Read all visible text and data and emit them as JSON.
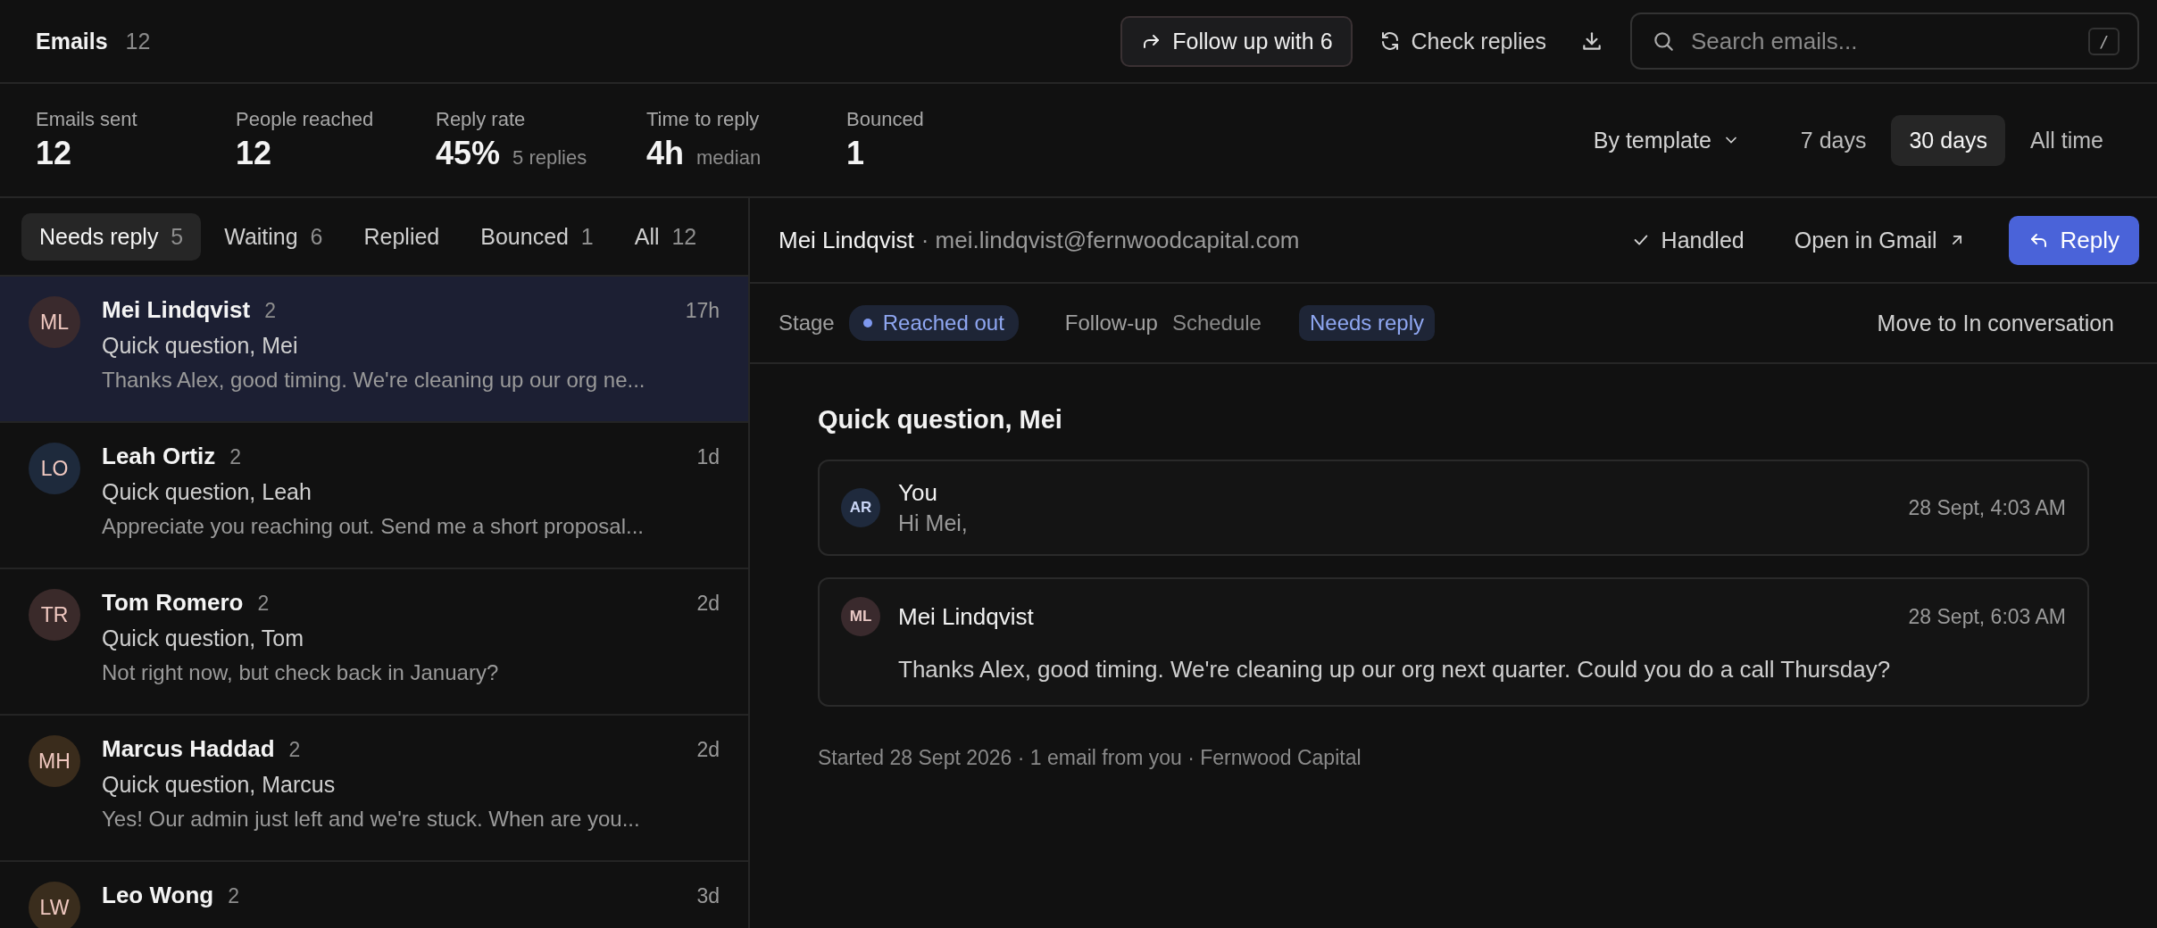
{
  "header": {
    "title": "Emails",
    "count": "12",
    "follow_up_button": "Follow up with 6",
    "check_replies_button": "Check replies",
    "search": {
      "placeholder": "Search emails...",
      "shortcut": "/"
    }
  },
  "stats": [
    {
      "label": "Emails sent",
      "value": "12"
    },
    {
      "label": "People reached",
      "value": "12"
    },
    {
      "label": "Reply rate",
      "value": "45%",
      "note": "5 replies"
    },
    {
      "label": "Time to reply",
      "value": "4h",
      "note": "median"
    },
    {
      "label": "Bounced",
      "value": "1"
    }
  ],
  "grouping": "By template",
  "periods": [
    {
      "label": "7 days",
      "selected": false
    },
    {
      "label": "30 days",
      "selected": true
    },
    {
      "label": "All time",
      "selected": false
    }
  ],
  "tabs": [
    {
      "label": "Needs reply",
      "count": "5",
      "selected": true
    },
    {
      "label": "Waiting",
      "count": "6",
      "selected": false
    },
    {
      "label": "Replied",
      "selected": false
    },
    {
      "label": "Bounced",
      "count": "1",
      "selected": false
    },
    {
      "label": "All",
      "count": "12",
      "selected": false
    }
  ],
  "threads": [
    {
      "initials": "ML",
      "color": "#3a2a2d",
      "name": "Mei Lindqvist",
      "count": "2",
      "time": "17h",
      "subject": "Quick question, Mei",
      "preview": "Thanks Alex, good timing. We're cleaning up our org ne...",
      "selected": true
    },
    {
      "initials": "LO",
      "color": "#1e2a3c",
      "name": "Leah Ortiz",
      "count": "2",
      "time": "1d",
      "subject": "Quick question, Leah",
      "preview": "Appreciate you reaching out. Send me a short proposal...",
      "selected": false
    },
    {
      "initials": "TR",
      "color": "#3a2a2a",
      "name": "Tom Romero",
      "count": "2",
      "time": "2d",
      "subject": "Quick question, Tom",
      "preview": "Not right now, but check back in January?",
      "selected": false
    },
    {
      "initials": "MH",
      "color": "#3a2c1c",
      "name": "Marcus Haddad",
      "count": "2",
      "time": "2d",
      "subject": "Quick question, Marcus",
      "preview": "Yes! Our admin just left and we're stuck. When are you...",
      "selected": false
    },
    {
      "initials": "LW",
      "color": "#3a2d1d",
      "name": "Leo Wong",
      "count": "2",
      "time": "3d",
      "selected": false
    }
  ],
  "detail": {
    "name": "Mei Lindqvist",
    "email": "· mei.lindqvist@fernwoodcapital.com",
    "handled_button": "Handled",
    "open_button": "Open in Gmail",
    "reply_button": "Reply",
    "stage_label": "Stage",
    "stage": "Reached out",
    "followup_label": "Follow-up",
    "followup_value": "Schedule",
    "status": "Needs reply",
    "move_button": "Move to In conversation",
    "subject": "Quick question, Mei",
    "messages": [
      {
        "kind": "collapsed",
        "initials": "AR",
        "color": "#1f2a3d",
        "sender": "You",
        "time": "28 Sept, 4:03 AM",
        "body": "Hi Mei,"
      },
      {
        "kind": "expanded",
        "initials": "ML",
        "color": "#3a2a2d",
        "sender": "Mei Lindqvist",
        "time": "28 Sept, 6:03 AM",
        "body": "Thanks Alex, good timing. We're cleaning up our org next quarter. Could you do a call Thursday?"
      }
    ],
    "footer": "Started 28 Sept 2026 · 1 email from you · Fernwood Capital"
  }
}
